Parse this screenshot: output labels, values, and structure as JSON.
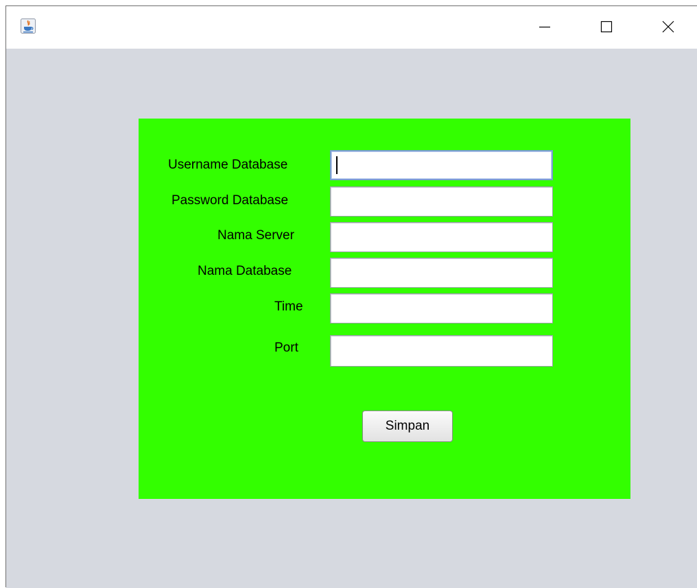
{
  "window": {
    "icon": "java-cup-icon",
    "controls": {
      "minimize": "minimize-icon",
      "maximize": "maximize-icon",
      "close": "close-icon"
    }
  },
  "form": {
    "background_color": "#33ff00",
    "fields": [
      {
        "label": "Username Database",
        "value": "",
        "placeholder": ""
      },
      {
        "label": "Password Database",
        "value": "",
        "placeholder": ""
      },
      {
        "label": "Nama Server",
        "value": "",
        "placeholder": ""
      },
      {
        "label": "Nama Database",
        "value": "",
        "placeholder": ""
      },
      {
        "label": "Time",
        "value": "",
        "placeholder": ""
      },
      {
        "label": "Port",
        "value": "",
        "placeholder": ""
      }
    ],
    "submit_label": "Simpan"
  }
}
